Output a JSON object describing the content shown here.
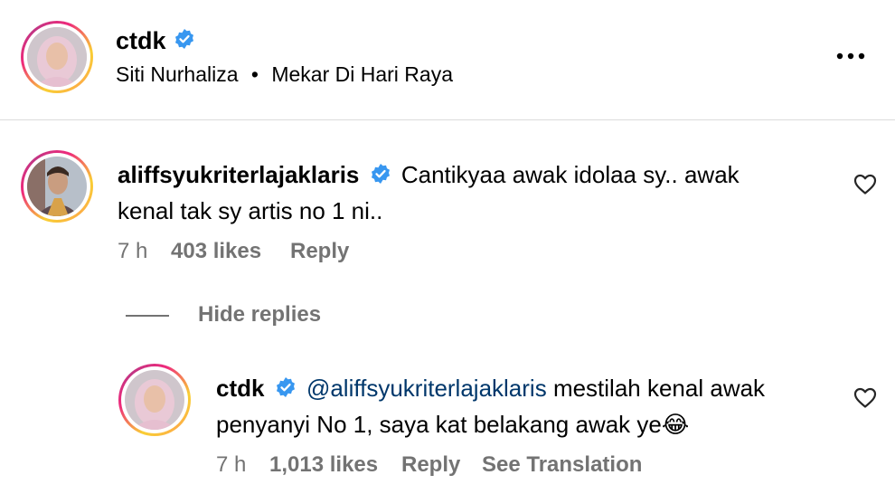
{
  "post": {
    "username": "ctdk",
    "subtitle_artist": "Siti Nurhaliza",
    "subtitle_sep": "•",
    "subtitle_song": "Mekar Di Hari Raya",
    "more_icon": "more-horizontal-icon"
  },
  "comment": {
    "username": "aliffsyukriterlajaklaris",
    "text_line1": "Cantikyaa awak idolaa sy.. awak",
    "text_line2": "kenal tak sy artis no 1 ni..",
    "time": "7 h",
    "likes": "403 likes",
    "reply_label": "Reply",
    "hide_replies_label": "Hide replies"
  },
  "reply": {
    "username": "ctdk",
    "mention": "@aliffsyukriterlajaklaris",
    "text_line1": "mestilah kenal awak",
    "text_line2": "penyanyi No 1, saya kat belakang awak ye",
    "emoji": "😂",
    "time": "7 h",
    "likes": "1,013 likes",
    "reply_label": "Reply",
    "translate_label": "See Translation"
  },
  "colors": {
    "verified": "#3897f0",
    "meta": "#737373",
    "link": "#00376b",
    "divider": "#dbdbdb"
  }
}
